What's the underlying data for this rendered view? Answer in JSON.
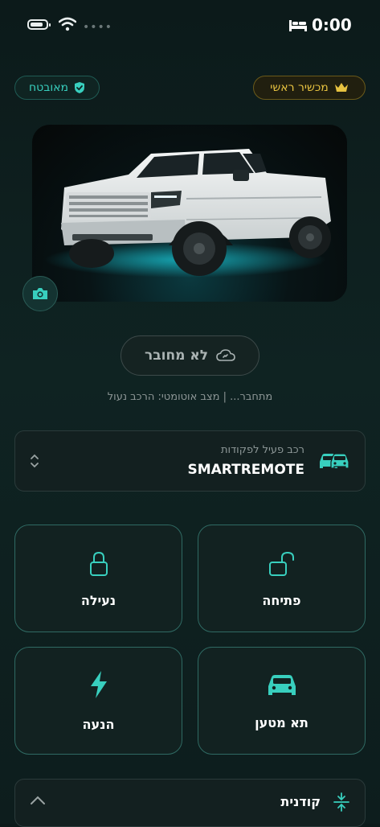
{
  "status_bar": {
    "time": "0:00",
    "icons": [
      "battery-icon",
      "wifi-icon",
      "bed-icon"
    ]
  },
  "badges": {
    "premium_label": "מכשיר ראשי",
    "secure_label": "מאובטח"
  },
  "connection": {
    "button_label": "לא מחובר",
    "status_text": "מתחבר... | מצב אוטומטי: הרכב נעול"
  },
  "vehicle": {
    "subtitle": "רכב פעיל לפקודות",
    "name": "SMARTREMOTE"
  },
  "actions": [
    {
      "label": "פתיחה",
      "icon": "unlock-icon"
    },
    {
      "label": "נעילה",
      "icon": "lock-icon"
    },
    {
      "label": "תא מטען",
      "icon": "car-icon"
    },
    {
      "label": "הנעה",
      "icon": "bolt-icon"
    }
  ],
  "priority": {
    "label": "קודנית"
  },
  "colors": {
    "accent": "#38cfbe",
    "premium": "#e7c240",
    "background": "#0f2322"
  }
}
